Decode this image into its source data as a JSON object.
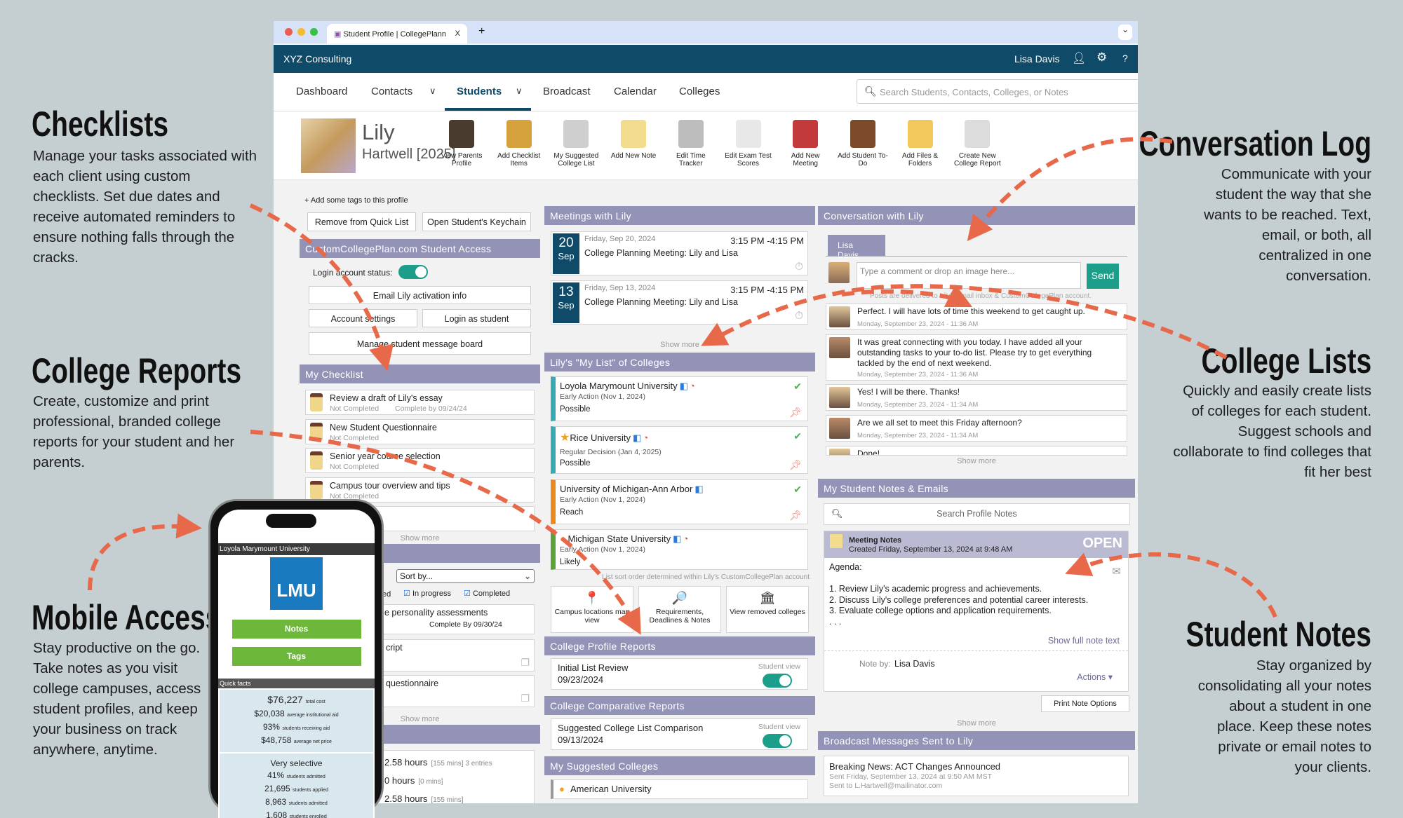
{
  "annotations": {
    "checklists": {
      "title": "Checklists",
      "text": "Manage your tasks associated with each client using custom checklists. Set due dates and receive automated reminders to ensure nothing falls through the cracks."
    },
    "college_reports": {
      "title": "College Reports",
      "text": "Create, customize and print professional, branded college reports for your student and her parents."
    },
    "mobile_access": {
      "title": "Mobile Access",
      "text": "Stay productive on the go. Take notes as you visit college campuses, access student profiles, and keep your business on track anywhere, anytime."
    },
    "conversation_log": {
      "title": "Conversation Log",
      "text": "Communicate with your student the way that she wants to be reached. Text, email, or both, all centralized in one conversation."
    },
    "college_lists": {
      "title": "College Lists",
      "text": "Quickly and easily create lists of colleges for each student. Suggest schools and collaborate to find colleges that fit her best"
    },
    "student_notes": {
      "title": "Student Notes",
      "text": "Stay organized by consolidating all your notes about a student in one place. Keep these notes private or email notes to your clients."
    }
  },
  "colors": {
    "accent_arrow": "#e8684a",
    "header": "#0f4b69",
    "section": "#9393b8",
    "toggle": "#1c9e8b"
  },
  "browser": {
    "tab_title": "Student Profile | CollegePlann",
    "tab_close": "X",
    "new_tab": "+",
    "menu": "⌄"
  },
  "header": {
    "org": "XYZ Consulting",
    "user": "Lisa Davis",
    "icons": [
      "user-icon",
      "gear-icon",
      "help-icon"
    ],
    "help": "?"
  },
  "nav": {
    "items": [
      "Dashboard",
      "Contacts",
      "Students",
      "Broadcast",
      "Calendar",
      "Colleges"
    ],
    "active": "Students",
    "search_placeholder": "Search Students, Contacts, Colleges, or Notes"
  },
  "profile": {
    "first": "Lily",
    "last": "Hartwell [2025]",
    "tools": [
      "View Parents Profile",
      "Add Checklist Items",
      "My Suggested College List",
      "Add New Note",
      "Edit Time Tracker",
      "Edit Exam Test Scores",
      "Add New Meeting",
      "Add Student To-Do",
      "Add Files & Folders",
      "Create New College Report"
    ]
  },
  "left": {
    "tags": "+ Add some tags to this profile",
    "remove_quick": "Remove from Quick List",
    "keychain": "Open Student's Keychain",
    "access_title": "CustomCollegePlan.com Student Access",
    "login_status": "Login account status:",
    "login_on": true,
    "email_activation": "Email Lily activation info",
    "account_settings": "Account settings",
    "login_as": "Login as student",
    "message_board": "Manage student message board",
    "checklist_title": "My Checklist",
    "checklist": [
      {
        "title": "Review a draft of Lily's essay",
        "status": "Not Completed",
        "due": "Complete by 09/24/24"
      },
      {
        "title": "New Student Questionnaire",
        "status": "Not Completed"
      },
      {
        "title": "Senior year course selection",
        "status": "Not Completed"
      },
      {
        "title": "Campus tour overview and tips",
        "status": "Not Completed"
      },
      {
        "title": "esume"
      }
    ],
    "show_more": "Show more",
    "sort_by": "Sort by...",
    "filters": [
      "ed",
      "In progress",
      "Completed"
    ],
    "todos": [
      {
        "title": "e personality assessments",
        "due": "Complete By 09/30/24"
      },
      {
        "title": "cript"
      },
      {
        "title": "questionnaire"
      }
    ],
    "time": [
      {
        "hours": "2.58 hours",
        "detail": "[155 mins] 3 entries"
      },
      {
        "hours": "0 hours",
        "detail": "[0 mins]"
      },
      {
        "hours": "2.58 hours",
        "detail": "[155 mins]"
      }
    ]
  },
  "meetings": {
    "title": "Meetings with Lily",
    "items": [
      {
        "day": "20",
        "mon": "Sep",
        "date": "Friday, Sep 20, 2024",
        "time": "3:15 PM -4:15 PM",
        "title": "College Planning Meeting: Lily and Lisa"
      },
      {
        "day": "13",
        "mon": "Sep",
        "date": "Friday, Sep 13, 2024",
        "time": "3:15 PM -4:15 PM",
        "title": "College Planning Meeting: Lily and Lisa"
      }
    ],
    "show_more": "Show more"
  },
  "mylist": {
    "title": "Lily's \"My List\" of Colleges",
    "items": [
      {
        "name": "Loyola Marymount University",
        "plan": "Early Action (Nov 1, 2024)",
        "fit": "Possible",
        "color": "#3aaab5"
      },
      {
        "name": "Rice University",
        "plan": "Regular Decision (Jan 4, 2025)",
        "fit": "Possible",
        "color": "#3aaab5",
        "star": true
      },
      {
        "name": "University of Michigan-Ann Arbor",
        "plan": "Early Action (Nov 1, 2024)",
        "fit": "Reach",
        "color": "#e98a1f"
      },
      {
        "name": "Michigan State University",
        "plan": "Early Action (Nov 1, 2024)",
        "fit": "Likely",
        "color": "#5aa33a"
      }
    ],
    "sort_note": "List sort order determined within Lily's CustomCollegePlan account",
    "tiles": [
      "Campus locations map view",
      "Requirements, Deadlines & Notes",
      "View removed colleges"
    ]
  },
  "reports": {
    "profile_title": "College Profile Reports",
    "profile_item": {
      "name": "Initial List Review",
      "date": "09/23/2024",
      "view": "Student view",
      "on": true
    },
    "comp_title": "College Comparative Reports",
    "comp_item": {
      "name": "Suggested College List Comparison",
      "date": "09/13/2024",
      "view": "Student view",
      "on": true
    },
    "suggested_title": "My Suggested Colleges",
    "suggested_first": "American University"
  },
  "conversation": {
    "title": "Conversation with Lily",
    "tab": "Lisa Davis",
    "placeholder": "Type a comment or drop an image here...",
    "send": "Send",
    "delivery_note": "Posts are delivered to Lily's email inbox & CustomCollegePlan account.",
    "messages": [
      {
        "text": "Perfect. I will have lots of time this weekend to get caught up.",
        "time": "Monday, September 23, 2024 - 11:36 AM"
      },
      {
        "text": "It was great connecting with you today. I have added all your outstanding tasks to your to-do list. Please try to get everything tackled by the end of next weekend.",
        "time": "Monday, September 23, 2024 - 11:36 AM"
      },
      {
        "text": "Yes! I will be there. Thanks!",
        "time": "Monday, September 23, 2024 - 11:34 AM"
      },
      {
        "text": "Are we all set to meet this Friday afternoon?",
        "time": "Monday, September 23, 2024 - 11:34 AM"
      },
      {
        "text": "Done!"
      }
    ],
    "show_more": "Show more"
  },
  "notes": {
    "title": "My Student Notes & Emails",
    "search_placeholder": "Search Profile Notes",
    "note": {
      "title": "Meeting Notes",
      "created": "Created Friday, September 13, 2024 at 9:48 AM",
      "badge": "OPEN",
      "lines": [
        "Agenda:",
        "1. Review Lily's academic progress and achievements.",
        "2. Discuss Lily's college preferences and potential career interests.",
        "3. Evaluate college options and application requirements.",
        ". . ."
      ],
      "show_full": "Show full note text",
      "by_label": "Note by:",
      "by": "Lisa Davis",
      "actions": "Actions ▾"
    },
    "print": "Print Note Options",
    "show_more": "Show more"
  },
  "broadcast": {
    "title": "Broadcast Messages Sent to Lily",
    "item": {
      "title": "Breaking News: ACT Changes Announced",
      "sent": "Sent Friday, September 13, 2024 at 9:50 AM MST",
      "to": "Sent to L.Hartwell@mailinator.com"
    }
  },
  "phone": {
    "college": "Loyola Marymount University",
    "logo": "LMU",
    "notes": "Notes",
    "tags": "Tags",
    "quick_facts": "Quick facts",
    "costs": [
      {
        "v": "$76,227",
        "l": "total cost"
      },
      {
        "v": "$20,038",
        "l": "average institutional aid"
      },
      {
        "v": "93%",
        "l": "students receiving aid"
      },
      {
        "v": "$48,758",
        "l": "average net price"
      }
    ],
    "selectivity": "Very selective",
    "admissions": [
      {
        "v": "41%",
        "l": "students admitted"
      },
      {
        "v": "21,695",
        "l": "students applied"
      },
      {
        "v": "8,963",
        "l": "students admitted"
      },
      {
        "v": "1,608",
        "l": "students enrolled"
      }
    ]
  }
}
